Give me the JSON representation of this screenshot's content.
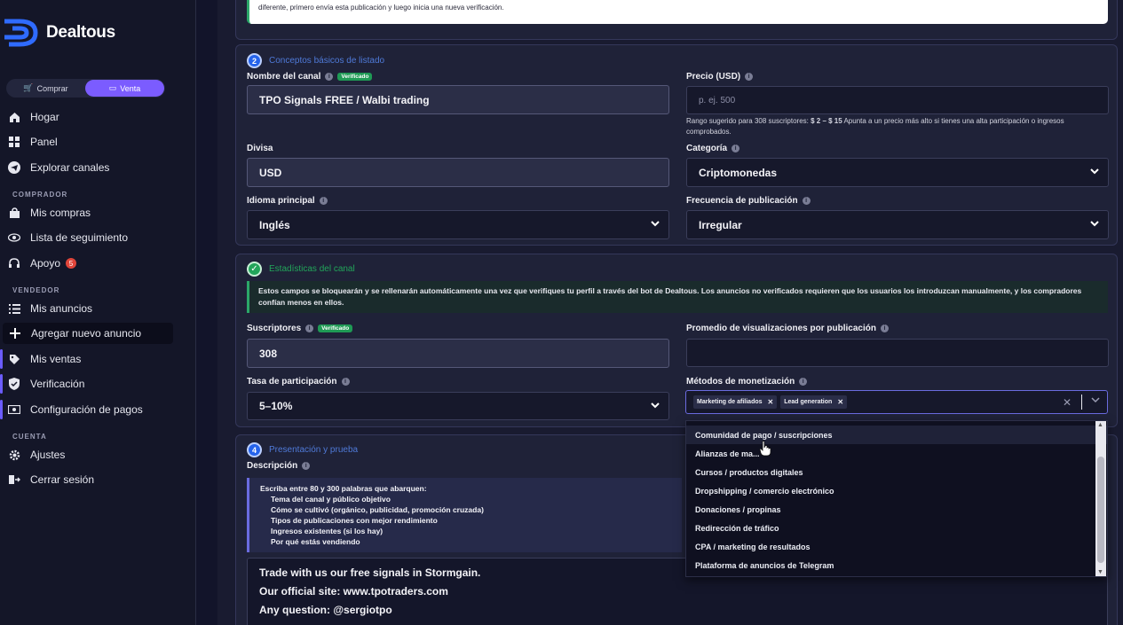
{
  "brand": {
    "name": "Dealtous"
  },
  "toggle": {
    "buy": "Comprar",
    "sell": "Venta"
  },
  "nav": {
    "home": "Hogar",
    "panel": "Panel",
    "explore": "Explorar canales",
    "buyer_section": "COMPRADOR",
    "purchases": "Mis compras",
    "watchlist": "Lista de seguimiento",
    "support": "Apoyo",
    "support_badge": "5",
    "seller_section": "VENDEDOR",
    "my_listings": "Mis anuncios",
    "add_listing": "Agregar nuevo anuncio",
    "my_sales": "Mis ventas",
    "verification": "Verificación",
    "payment_config": "Configuración de pagos",
    "account_section": "CUENTA",
    "settings": "Ajustes",
    "logout": "Cerrar sesión"
  },
  "top_notice": "diferente, primero envía esta publicación y luego inicia una nueva verificación.",
  "section2": {
    "number": "2",
    "title": "Conceptos básicos de listado",
    "channel_name_label": "Nombre del canal",
    "verified": "Verificado",
    "channel_name_value": "TPO Signals FREE / Walbi trading",
    "price_label": "Precio (USD)",
    "price_placeholder": "p. ej. 500",
    "price_hint_pre": "Rango sugerido para 308 suscriptores: ",
    "price_hint_range": "$ 2 – $ 15",
    "price_hint_post": " Apunta a un precio más alto si tienes una alta participación o ingresos comprobados.",
    "currency_label": "Divisa",
    "currency_value": "USD",
    "category_label": "Categoría",
    "category_value": "Criptomonedas",
    "language_label": "Idioma principal",
    "language_value": "Inglés",
    "frequency_label": "Frecuencia de publicación",
    "frequency_value": "Irregular"
  },
  "section3": {
    "title": "Estadísticas del canal",
    "notice": "Estos campos se bloquearán y se rellenarán automáticamente una vez que verifiques tu perfil a través del bot de Dealtous. Los anuncios no verificados requieren que los usuarios los introduzcan manualmente, y los compradores confían menos en ellos.",
    "subscribers_label": "Suscriptores",
    "verified": "Verificado",
    "subscribers_value": "308",
    "avg_views_label": "Promedio de visualizaciones por publicación",
    "engagement_label": "Tasa de participación",
    "engagement_value": "5–10%",
    "monetization_label": "Métodos de monetización",
    "chips": [
      "Marketing de afiliados",
      "Lead generation"
    ]
  },
  "dropdown": {
    "options": [
      "Comunidad de pago / suscripciones",
      "Alianzas de ma...",
      "Cursos / productos digitales",
      "Dropshipping / comercio electrónico",
      "Donaciones / propinas",
      "Redirección de tráfico",
      "CPA / marketing de resultados",
      "Plataforma de anuncios de Telegram"
    ]
  },
  "section4": {
    "number": "4",
    "title": "Presentación y prueba",
    "description_label": "Descripción",
    "instructions_intro": "Escriba entre 80 y 300 palabras que abarquen:",
    "instructions": [
      "Tema del canal y público objetivo",
      "Cómo se cultivó (orgánico, publicidad, promoción cruzada)",
      "Tipos de publicaciones con mejor rendimiento",
      "Ingresos existentes (si los hay)",
      "Por qué estás vendiendo"
    ],
    "description_lines": [
      "Trade with us our free signals in Stormgain.",
      "Our official site: www.tpotraders.com",
      "Any question: @sergiotpo"
    ]
  }
}
